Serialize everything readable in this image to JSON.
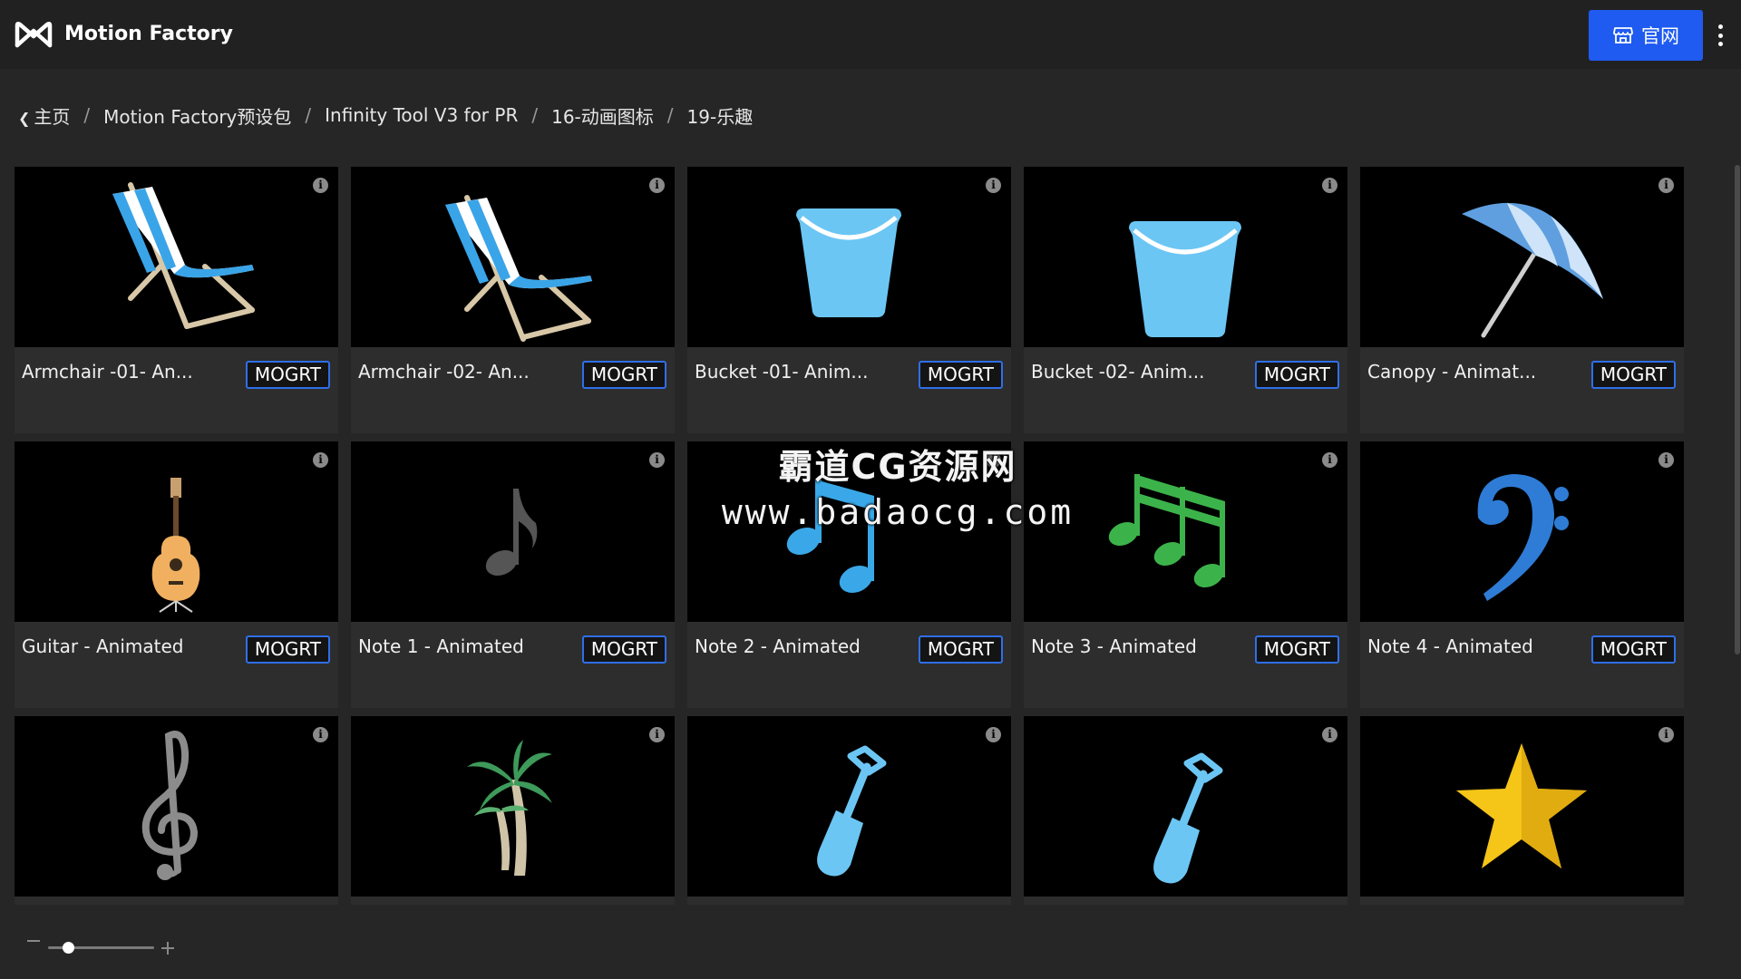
{
  "header": {
    "app_title": "Motion Factory",
    "site_button_label": "官网"
  },
  "breadcrumb": [
    "主页",
    "Motion Factory预设包",
    "Infinity Tool V3 for PR",
    "16-动画图标",
    "19-乐趣"
  ],
  "badge_label": "MOGRT",
  "info_icon_glyph": "i",
  "cards": [
    {
      "title": "Armchair -01- An...",
      "icon": "beach-chair"
    },
    {
      "title": "Armchair -02- An...",
      "icon": "beach-chair"
    },
    {
      "title": "Bucket -01- Anim...",
      "icon": "bucket"
    },
    {
      "title": "Bucket -02- Anim...",
      "icon": "bucket"
    },
    {
      "title": "Canopy - Animat...",
      "icon": "beach-umbrella"
    },
    {
      "title": "Guitar - Animated",
      "icon": "guitar"
    },
    {
      "title": "Note 1 - Animated",
      "icon": "eighth-note"
    },
    {
      "title": "Note 2 - Animated",
      "icon": "beamed-notes"
    },
    {
      "title": "Note 3 - Animated",
      "icon": "triple-notes"
    },
    {
      "title": "Note 4 - Animated",
      "icon": "bass-clef"
    },
    {
      "title": "",
      "icon": "treble-clef"
    },
    {
      "title": "",
      "icon": "palm-tree"
    },
    {
      "title": "",
      "icon": "shovel"
    },
    {
      "title": "",
      "icon": "shovel"
    },
    {
      "title": "",
      "icon": "star"
    }
  ],
  "watermark": {
    "line1": "霸道CG资源网",
    "line2": "www.badaocg.com"
  },
  "zoom": {
    "level": 0.15
  },
  "colors": {
    "accent": "#1f5bf0",
    "badge_border": "#2f6fe8",
    "chair_blue": "#3aa4e8",
    "bucket_blue": "#6cc6f4",
    "note_green": "#3cb34a",
    "bass_clef_blue": "#2e7cd6",
    "star_yellow": "#f5c518"
  }
}
